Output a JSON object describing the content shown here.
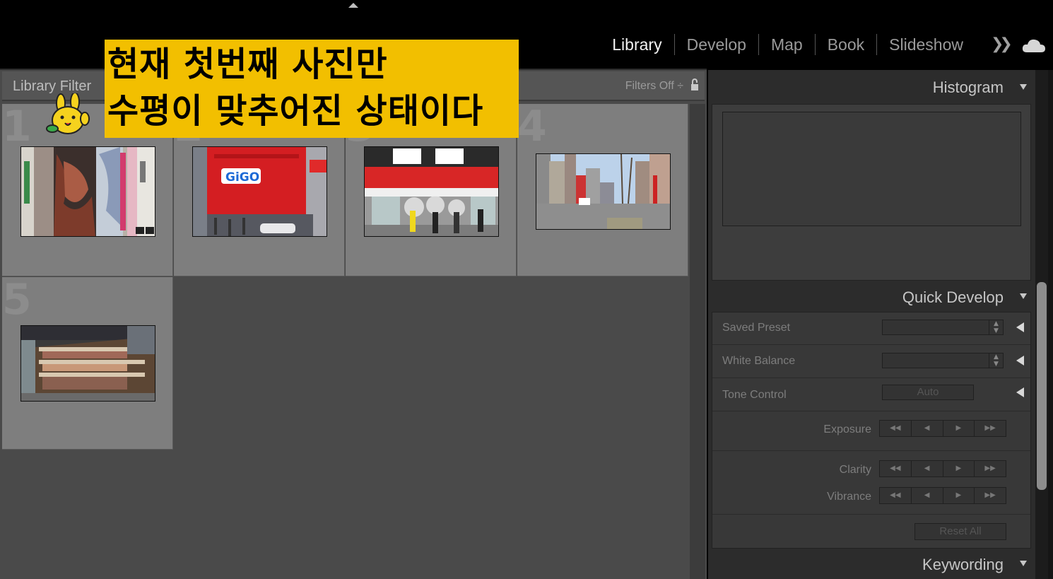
{
  "modules": [
    "Library",
    "Develop",
    "Map",
    "Book",
    "Slideshow"
  ],
  "active_module": "Library",
  "icons": {
    "more": "double-chevron-right-icon",
    "cloud": "cloud-icon",
    "lock": "lock-icon",
    "collapse": "triangle-up-icon",
    "mascot": "rabbit-mascot-sticker"
  },
  "library_filter": {
    "title": "Library Filter",
    "filters_state": "Filters Off"
  },
  "annotation": {
    "line1": "현재 첫번째 사진만",
    "line2": "수평이 맞추어진 상태이다",
    "background": "#f2bf00"
  },
  "grid": {
    "cells": [
      {
        "number": "1",
        "badge": "⊞⊠"
      },
      {
        "number": "2"
      },
      {
        "number": "3"
      },
      {
        "number": "4"
      },
      {
        "number": "5"
      }
    ]
  },
  "right_panel": {
    "histogram": {
      "title": "Histogram"
    },
    "quick_develop": {
      "title": "Quick Develop",
      "saved_preset_label": "Saved Preset",
      "white_balance_label": "White Balance",
      "tone_control_label": "Tone Control",
      "auto_label": "Auto",
      "exposure_label": "Exposure",
      "clarity_label": "Clarity",
      "vibrance_label": "Vibrance",
      "reset_all_label": "Reset All",
      "step_glyphs": [
        "◀◀",
        "◀",
        "▶",
        "▶▶"
      ]
    },
    "keywording": {
      "title": "Keywording"
    }
  }
}
